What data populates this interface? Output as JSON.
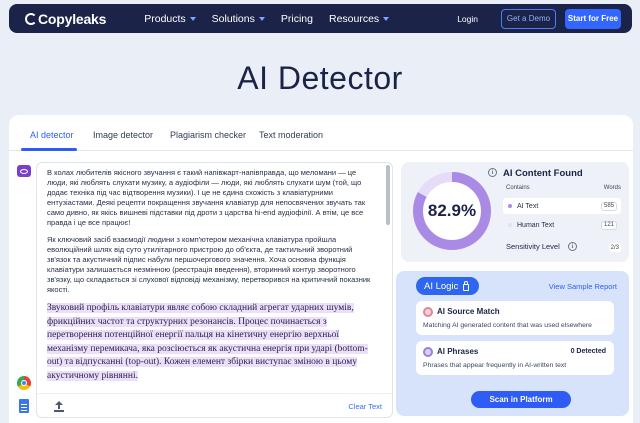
{
  "navbar": {
    "logo": "Copyleaks",
    "links": [
      {
        "label": "Products",
        "has_dropdown": true
      },
      {
        "label": "Solutions",
        "has_dropdown": true
      },
      {
        "label": "Pricing",
        "has_dropdown": false
      },
      {
        "label": "Resources",
        "has_dropdown": true
      }
    ],
    "login": "Login",
    "demo": "Get a Demo",
    "start": "Start for Free"
  },
  "hero": {
    "title": "AI Detector"
  },
  "tabs": [
    {
      "label": "AI detector",
      "active": true
    },
    {
      "label": "Image detector",
      "active": false
    },
    {
      "label": "Plagiarism checker",
      "active": false
    },
    {
      "label": "Text moderation",
      "active": false
    }
  ],
  "editor": {
    "paragraph1": "В колах любителів якісного звучання є такий напівжарт-напівправда, що меломани — це люди, які люблять слухати музику, а аудіофіли — люди, які люблять слухати шум (той, що додає техніка під час відтворення музики). І це не єдина схожість з клавіатурними ентузіастами. Деякі рецепти покращення звучання клавіатур для непосвячених звучать так само дивно, як якісь вишневі підставки під дроти з царства hi-end аудіофілії. А втім, це все правда і це все працює!",
    "paragraph2": "Як ключовий засіб взаємодії людини з комп'ютером механічна клавіатура пройшла еволюційний шлях від суто утилітарного пристрою до об'єкта, де тактильний зворотний зв'язок та акустичний підпис набули першочергового значення. Хоча основна функція клавіатури залишається незмінною (реєстрація введення), вторинний контур зворотного зв'язку, що складається зі слухової відповіді механізму, перетворився на критичний показник якості.",
    "paragraph3_ai": "Звуковий профіль клавіатури являє собою складний агрегат ударних шумів, фрикційних частот та структурних резонансів. Процес починається з перетворення потенційної енергії пальця на кінетичну енергію верхньої механізму перемикача, яка розсіюється як акустична енергія при ударі (bottom-out) та відпусканні (top-out). Кожен елемент збірки виступає зміною в цьому акустичному рівнянні.",
    "clear": "Clear Text"
  },
  "result": {
    "score": "82.9%",
    "score_fraction": 0.829,
    "title": "AI Content Found",
    "col_contains": "Contains",
    "col_words": "Words",
    "ai_label": "AI Text",
    "ai_words": "585",
    "human_label": "Human Text",
    "human_words": "121",
    "sensitivity_label": "Sensitivity Level",
    "sensitivity_value": "2/3"
  },
  "logic": {
    "pill": "AI Logic",
    "view_report": "View Sample Report",
    "source_title": "AI Source Match",
    "source_desc": "Matching AI generated content that was used elsewhere",
    "phrases_title": "AI Phrases",
    "phrases_count": "0 Detected",
    "phrases_desc": "Phrases that appear frequently in AI-written text",
    "scan": "Scan in Platform"
  },
  "colors": {
    "nav_bg": "#1b2448",
    "accent": "#2f5cf5",
    "ai_purple": "#a98be6",
    "human_lavender": "#e7dcf7",
    "highlight": "#ecdff7"
  }
}
